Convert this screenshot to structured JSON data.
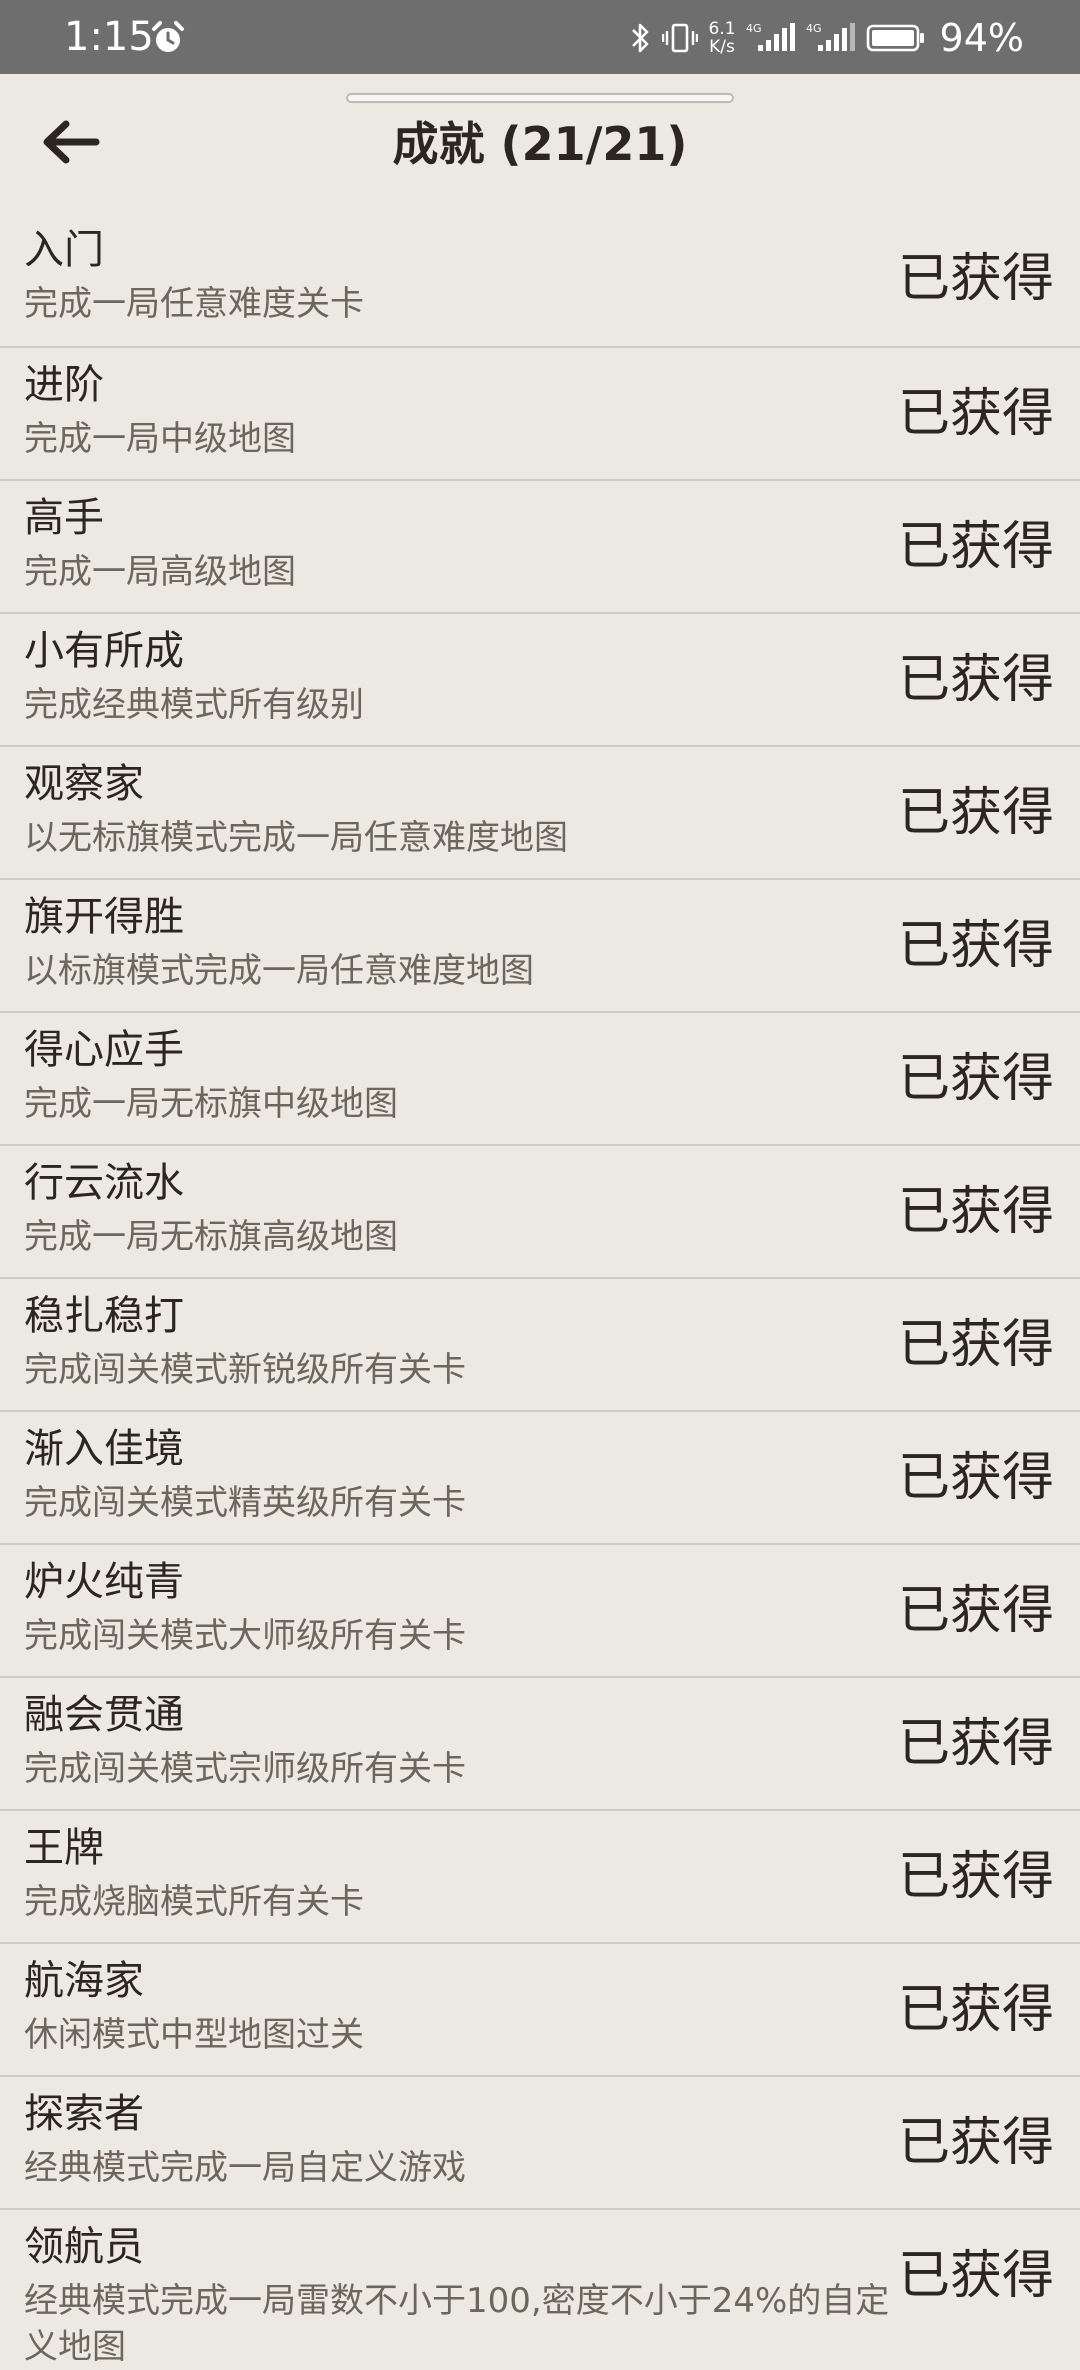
{
  "status_bar": {
    "time": "1:15",
    "net_speed_value": "6.1",
    "net_speed_unit": "K/s",
    "signal_1_label": "4G",
    "signal_2_label": "4G",
    "battery_percent": "94%"
  },
  "header": {
    "title": "成就 (21/21)"
  },
  "achievements": [
    {
      "title": "入门",
      "desc": "完成一局任意难度关卡",
      "status": "已获得"
    },
    {
      "title": "进阶",
      "desc": "完成一局中级地图",
      "status": "已获得"
    },
    {
      "title": "高手",
      "desc": "完成一局高级地图",
      "status": "已获得"
    },
    {
      "title": "小有所成",
      "desc": "完成经典模式所有级别",
      "status": "已获得"
    },
    {
      "title": "观察家",
      "desc": "以无标旗模式完成一局任意难度地图",
      "status": "已获得"
    },
    {
      "title": "旗开得胜",
      "desc": "以标旗模式完成一局任意难度地图",
      "status": "已获得"
    },
    {
      "title": "得心应手",
      "desc": "完成一局无标旗中级地图",
      "status": "已获得"
    },
    {
      "title": "行云流水",
      "desc": "完成一局无标旗高级地图",
      "status": "已获得"
    },
    {
      "title": "稳扎稳打",
      "desc": "完成闯关模式新锐级所有关卡",
      "status": "已获得"
    },
    {
      "title": "渐入佳境",
      "desc": "完成闯关模式精英级所有关卡",
      "status": "已获得"
    },
    {
      "title": "炉火纯青",
      "desc": "完成闯关模式大师级所有关卡",
      "status": "已获得"
    },
    {
      "title": "融会贯通",
      "desc": "完成闯关模式宗师级所有关卡",
      "status": "已获得"
    },
    {
      "title": "王牌",
      "desc": "完成烧脑模式所有关卡",
      "status": "已获得"
    },
    {
      "title": "航海家",
      "desc": "休闲模式中型地图过关",
      "status": "已获得"
    },
    {
      "title": "探索者",
      "desc": "经典模式完成一局自定义游戏",
      "status": "已获得"
    },
    {
      "title": "领航员",
      "desc": "经典模式完成一局雷数不小于100,密度不小于24%的自定义地图",
      "status": "已获得"
    }
  ]
}
